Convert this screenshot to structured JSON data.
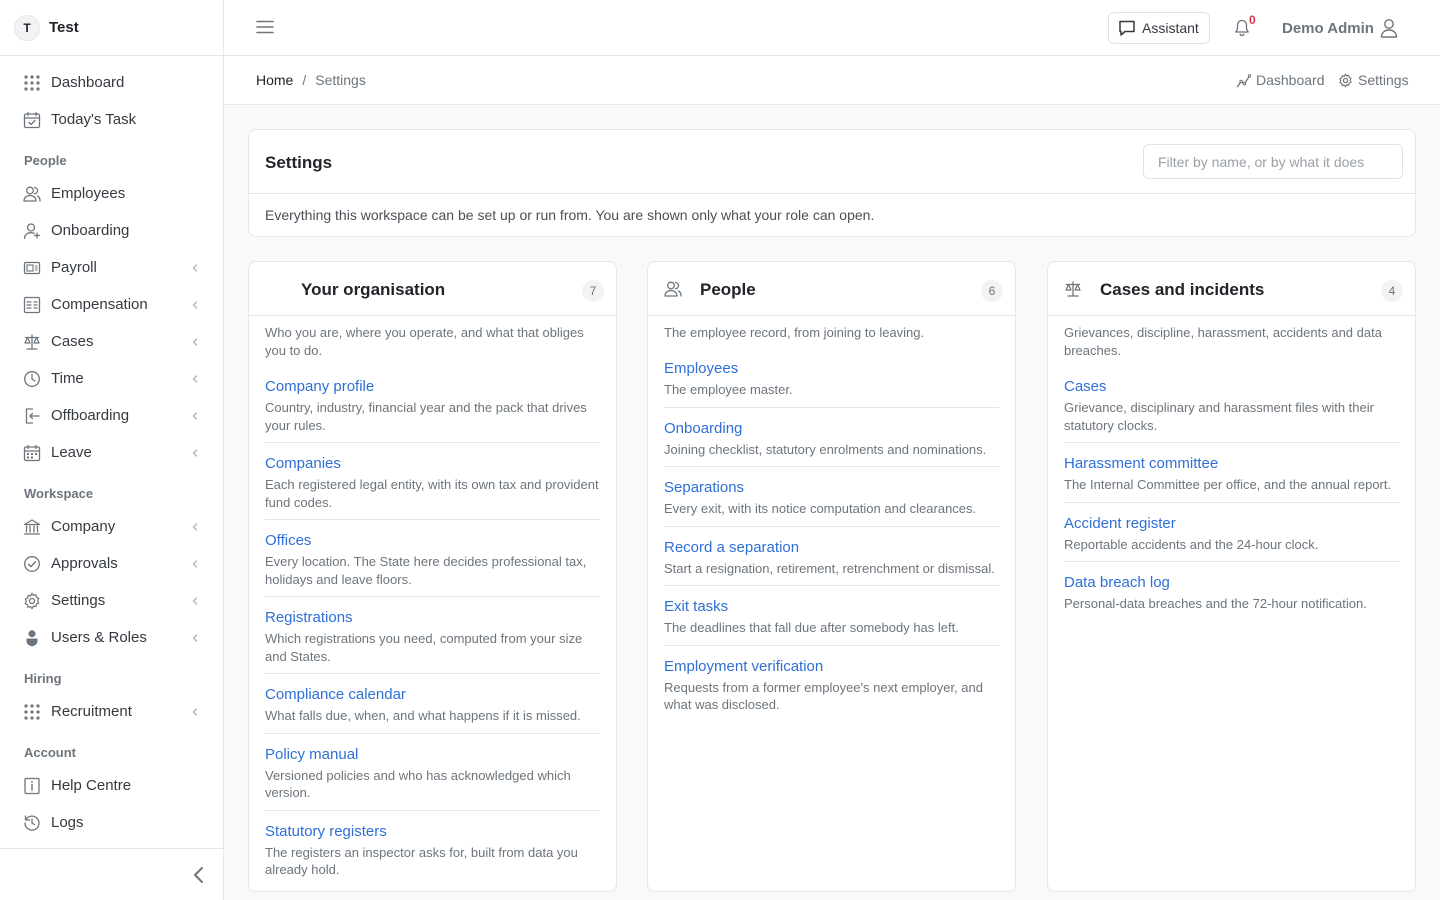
{
  "brand": {
    "initial": "T",
    "name": "Test"
  },
  "sidebar": {
    "top_items": [
      {
        "label": "Dashboard",
        "icon": "grid-icon"
      },
      {
        "label": "Today's Task",
        "icon": "calendar-check-icon"
      }
    ],
    "groups": [
      {
        "heading": "People",
        "items": [
          {
            "label": "Employees",
            "icon": "users-icon",
            "chevron": false
          },
          {
            "label": "Onboarding",
            "icon": "user-plus-icon",
            "chevron": false
          },
          {
            "label": "Payroll",
            "icon": "payroll-icon",
            "chevron": true
          },
          {
            "label": "Compensation",
            "icon": "compensation-icon",
            "chevron": true
          },
          {
            "label": "Cases",
            "icon": "scale-icon",
            "chevron": true
          },
          {
            "label": "Time",
            "icon": "clock-icon",
            "chevron": true
          },
          {
            "label": "Offboarding",
            "icon": "exit-icon",
            "chevron": true
          },
          {
            "label": "Leave",
            "icon": "calendar-icon",
            "chevron": true
          }
        ]
      },
      {
        "heading": "Workspace",
        "items": [
          {
            "label": "Company",
            "icon": "bank-icon",
            "chevron": true
          },
          {
            "label": "Approvals",
            "icon": "check-circle-icon",
            "chevron": true
          },
          {
            "label": "Settings",
            "icon": "gear-icon",
            "chevron": true
          },
          {
            "label": "Users & Roles",
            "icon": "user-shield-icon",
            "chevron": true
          }
        ]
      },
      {
        "heading": "Hiring",
        "items": [
          {
            "label": "Recruitment",
            "icon": "grid-icon",
            "chevron": true
          }
        ]
      },
      {
        "heading": "Account",
        "items": [
          {
            "label": "Help Centre",
            "icon": "info-book-icon",
            "chevron": false
          },
          {
            "label": "Logs",
            "icon": "history-icon",
            "chevron": false
          }
        ]
      }
    ]
  },
  "topbar": {
    "assistant_label": "Assistant",
    "notification_count": "0",
    "user_name": "Demo Admin"
  },
  "breadcrumb": {
    "home": "Home",
    "separator": "/",
    "current": "Settings"
  },
  "quick_links": {
    "dashboard": "Dashboard",
    "settings": "Settings"
  },
  "settings": {
    "title": "Settings",
    "filter_placeholder": "Filter by name, or by what it does",
    "description": "Everything this workspace can be set up or run from. You are shown only what your role can open."
  },
  "sections": [
    {
      "title": "Your organisation",
      "icon": "",
      "count": "7",
      "description": "Who you are, where you operate, and what that obliges you to do.",
      "entries": [
        {
          "label": "Company profile",
          "sub": "Country, industry, financial year and the pack that drives your rules."
        },
        {
          "label": "Companies",
          "sub": "Each registered legal entity, with its own tax and provident fund codes."
        },
        {
          "label": "Offices",
          "sub": "Every location. The State here decides professional tax, holidays and leave floors."
        },
        {
          "label": "Registrations",
          "sub": "Which registrations you need, computed from your size and States."
        },
        {
          "label": "Compliance calendar",
          "sub": "What falls due, when, and what happens if it is missed."
        },
        {
          "label": "Policy manual",
          "sub": "Versioned policies and who has acknowledged which version."
        },
        {
          "label": "Statutory registers",
          "sub": "The registers an inspector asks for, built from data you already hold."
        }
      ]
    },
    {
      "title": "People",
      "icon": "users-icon",
      "count": "6",
      "description": "The employee record, from joining to leaving.",
      "entries": [
        {
          "label": "Employees",
          "sub": "The employee master."
        },
        {
          "label": "Onboarding",
          "sub": "Joining checklist, statutory enrolments and nominations."
        },
        {
          "label": "Separations",
          "sub": "Every exit, with its notice computation and clearances."
        },
        {
          "label": "Record a separation",
          "sub": "Start a resignation, retirement, retrenchment or dismissal."
        },
        {
          "label": "Exit tasks",
          "sub": "The deadlines that fall due after somebody has left."
        },
        {
          "label": "Employment verification",
          "sub": "Requests from a former employee's next employer, and what was disclosed."
        }
      ]
    },
    {
      "title": "Cases and incidents",
      "icon": "scale-icon",
      "count": "4",
      "description": "Grievances, discipline, harassment, accidents and data breaches.",
      "entries": [
        {
          "label": "Cases",
          "sub": "Grievance, disciplinary and harassment files with their statutory clocks."
        },
        {
          "label": "Harassment committee",
          "sub": "The Internal Committee per office, and the annual report."
        },
        {
          "label": "Accident register",
          "sub": "Reportable accidents and the 24-hour clock."
        },
        {
          "label": "Data breach log",
          "sub": "Personal-data breaches and the 72-hour notification."
        }
      ]
    }
  ],
  "colors": {
    "link": "#2f6fd6",
    "badge": "#dc3545",
    "border": "#e5e7eb"
  }
}
